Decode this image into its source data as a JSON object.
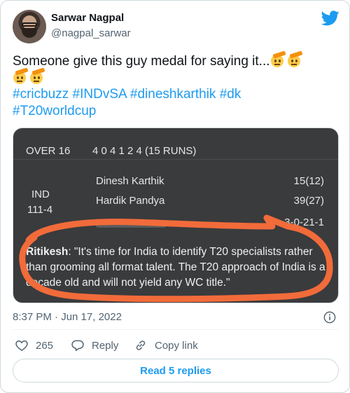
{
  "author": {
    "name": "Sarwar Nagpal",
    "handle": "@nagpal_sarwar"
  },
  "tweet": {
    "text_main": "Someone give this guy medal for saying it...",
    "emoji": "saluting-face",
    "hashtags": [
      "#cricbuzz",
      "#INDvSA",
      "#dineshkarthik",
      "#dk",
      "#T20worldcup"
    ]
  },
  "media": {
    "over_label": "OVER 16",
    "over_balls": "4 0 4 1 2 4 (15 RUNS)",
    "team": "IND",
    "team_score": "111-4",
    "batters": [
      {
        "name": "Dinesh Karthik",
        "runs": "15(12)"
      },
      {
        "name": "Hardik Pandya",
        "runs": "39(27)"
      }
    ],
    "bowler_figures": "3-0-21-1",
    "comment_author": "Ritikesh",
    "comment_text": ": \"It's time for India to identify T20 specialists rather than grooming all format talent. The T20 approach of India is a decade old and will not yield any WC title.\"",
    "scribble_color": "#f26b3a"
  },
  "meta": {
    "timestamp": "8:37 PM · Jun 17, 2022"
  },
  "actions": {
    "like_count": "265",
    "reply_label": "Reply",
    "copy_label": "Copy link"
  },
  "footer": {
    "read_replies_label": "Read 5 replies"
  },
  "colors": {
    "accent": "#1d9bf0",
    "secondary_text": "#536471",
    "border": "#cfd9de",
    "media_bg": "#3a3b3d"
  }
}
